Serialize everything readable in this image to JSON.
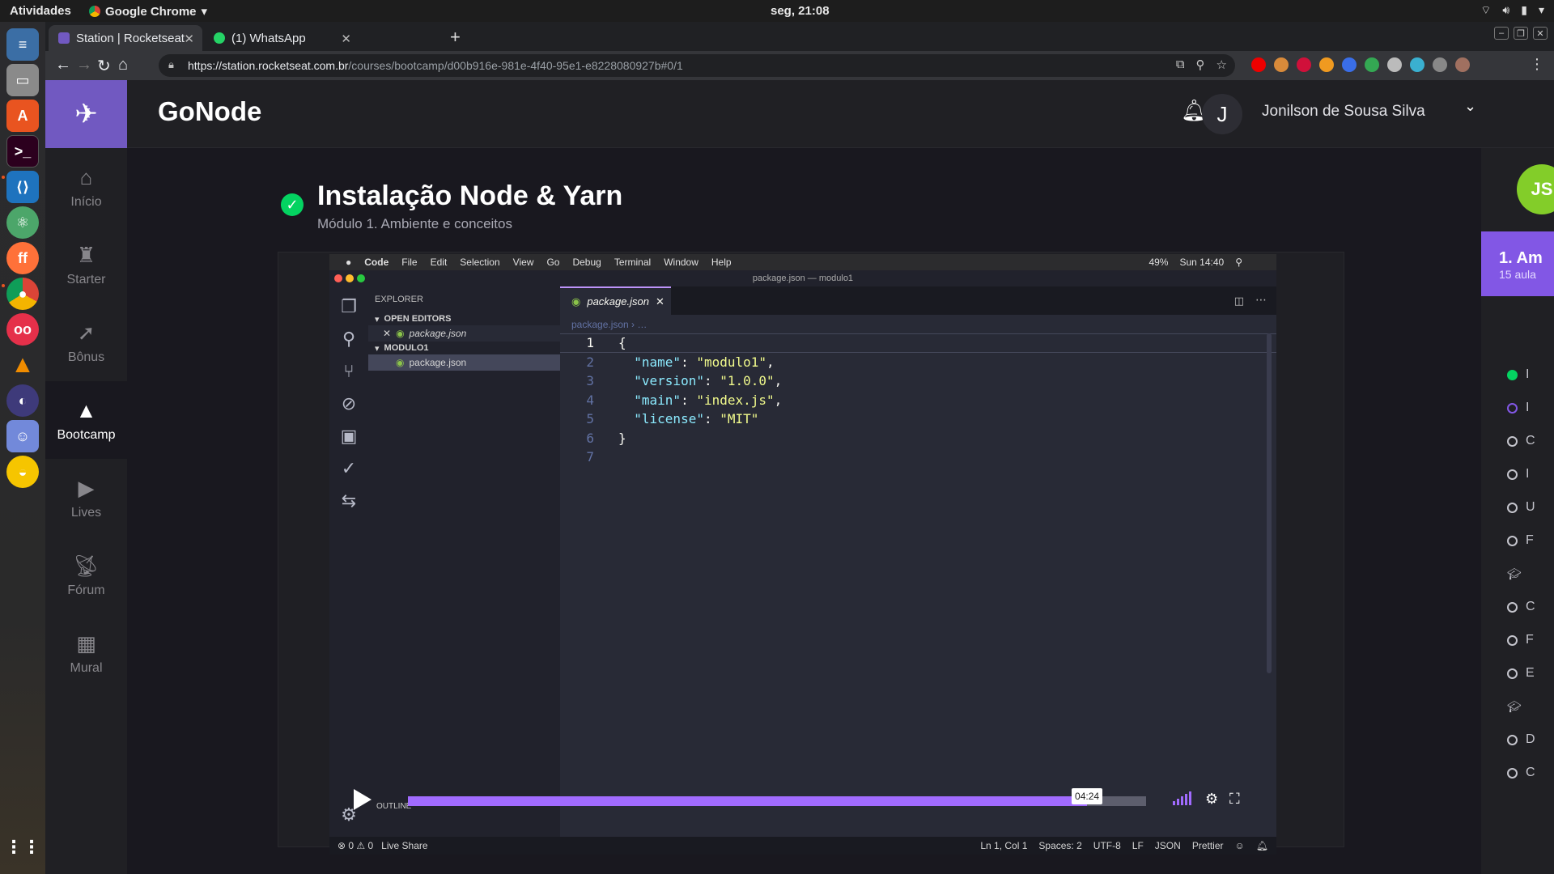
{
  "os": {
    "activities": "Atividades",
    "app_name": "Google Chrome",
    "clock": "seg, 21:08"
  },
  "browser": {
    "tabs": [
      {
        "title": "Station | Rocketseat"
      },
      {
        "title": "(1) WhatsApp"
      }
    ],
    "url_host": "https://station.rocketseat.com.br",
    "url_path": "/courses/bootcamp/d00b916e-981e-4f40-95e1-e8228080927b#0/1"
  },
  "site": {
    "course_title": "GoNode",
    "user_initial": "J",
    "user_name": "Jonilson de Sousa Silva",
    "nav": [
      {
        "label": "Início"
      },
      {
        "label": "Starter"
      },
      {
        "label": "Bônus"
      },
      {
        "label": "Bootcamp"
      },
      {
        "label": "Lives"
      },
      {
        "label": "Fórum"
      },
      {
        "label": "Mural"
      }
    ],
    "lesson": {
      "title": "Instalação Node & Yarn",
      "subtitle": "Módulo 1. Ambiente e conceitos"
    },
    "module": {
      "title": "1. Am",
      "subtitle": "15 aula"
    },
    "lesson_list": [
      "I",
      "I",
      "C",
      "I",
      "U",
      "F",
      "",
      "C",
      "F",
      "E",
      "",
      "D",
      "C"
    ]
  },
  "video": {
    "mac_menu": [
      "Code",
      "File",
      "Edit",
      "Selection",
      "View",
      "Go",
      "Debug",
      "Terminal",
      "Window",
      "Help"
    ],
    "mac_status": [
      "49%",
      "Sun 14:40"
    ],
    "window_title": "package.json — modulo1",
    "explorer": {
      "header": "EXPLORER",
      "open_editors": "OPEN EDITORS",
      "open_file": "package.json",
      "folder": "MODULO1",
      "file": "package.json"
    },
    "tab": "package.json",
    "breadcrumb": "package.json › …",
    "code": [
      {
        "n": "1",
        "text": "{"
      },
      {
        "n": "2",
        "key": "\"name\"",
        "val": "\"modulo1\""
      },
      {
        "n": "3",
        "key": "\"version\"",
        "val": "\"1.0.0\""
      },
      {
        "n": "4",
        "key": "\"main\"",
        "val": "\"index.js\""
      },
      {
        "n": "5",
        "key": "\"license\"",
        "val": "\"MIT\""
      },
      {
        "n": "6",
        "text": "}"
      },
      {
        "n": "7",
        "text": ""
      }
    ],
    "status_left": [
      "⊗ 0 ⚠ 0",
      "Live Share"
    ],
    "status_right": [
      "Ln 1, Col 1",
      "Spaces: 2",
      "UTF-8",
      "LF",
      "JSON",
      "Prettier"
    ],
    "outline": "OUTLINE",
    "time": "04:24",
    "progress": 0.92
  },
  "colors": {
    "brand": "#7159c1",
    "accent": "#8257e5",
    "success": "#04d361",
    "progress": "#a16bff"
  }
}
